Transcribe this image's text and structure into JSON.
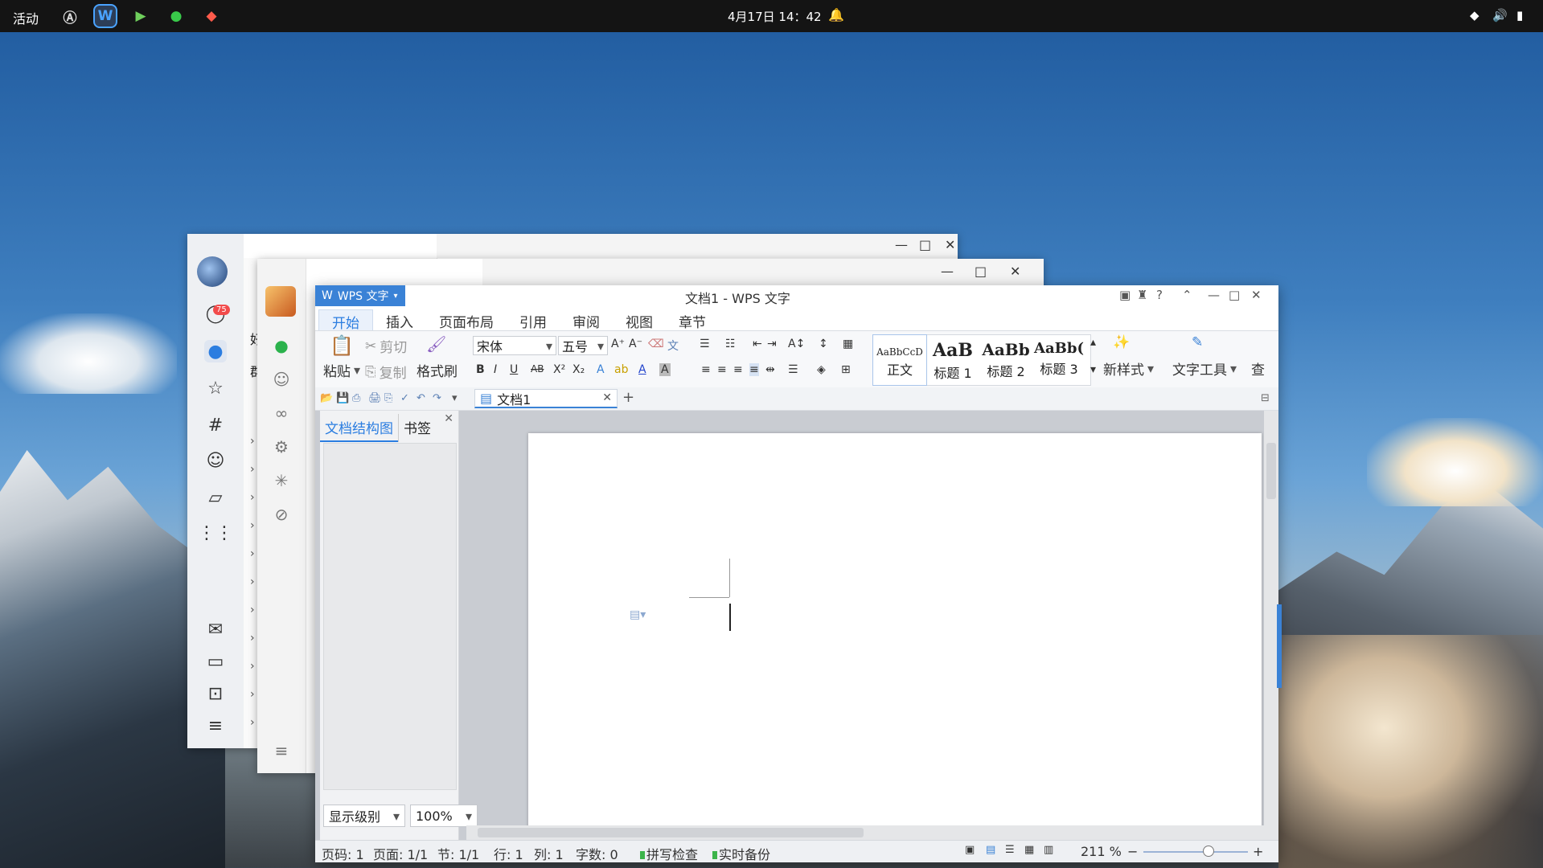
{
  "topbar": {
    "activities": "活动",
    "clock": "4月17日 14：42",
    "dock": [
      {
        "name": "app-store-icon",
        "glyph": "Ⓐ"
      },
      {
        "name": "wps-icon",
        "glyph": "W"
      },
      {
        "name": "media-player-icon",
        "glyph": "▶"
      },
      {
        "name": "wechat-icon",
        "glyph": "💬"
      },
      {
        "name": "qq-icon",
        "glyph": "🐧"
      }
    ]
  },
  "back_window_1": {
    "badge": "75",
    "partial_texts": [
      "好",
      "群"
    ]
  },
  "wps": {
    "brand": "WPS 文字",
    "title": "文档1 - WPS 文字",
    "menu_tabs": [
      "开始",
      "插入",
      "页面布局",
      "引用",
      "审阅",
      "视图",
      "章节"
    ],
    "ribbon": {
      "paste": "粘贴",
      "cut": "剪切",
      "copy": "复制",
      "format_painter": "格式刷",
      "font": "宋体",
      "size": "五号",
      "styles": [
        {
          "preview": "AaBbCcD",
          "name": "正文"
        },
        {
          "preview": "AaB",
          "name": "标题 1"
        },
        {
          "preview": "AaBb",
          "name": "标题 2"
        },
        {
          "preview": "AaBb(",
          "name": "标题 3"
        }
      ],
      "new_style": "新样式",
      "text_tools": "文字工具",
      "find": "查"
    },
    "doc_tab": "文档1",
    "nav": {
      "tab1": "文档结构图",
      "tab2": "书签",
      "level": "显示级别",
      "zoom": "100%"
    },
    "status": {
      "page_code": "页码: 1",
      "pages": "页面: 1/1",
      "section": "节: 1/1",
      "row": "行: 1",
      "col": "列: 1",
      "chars": "字数: 0",
      "spell": "拼写检查",
      "backup": "实时备份",
      "zoom": "211 %"
    }
  }
}
